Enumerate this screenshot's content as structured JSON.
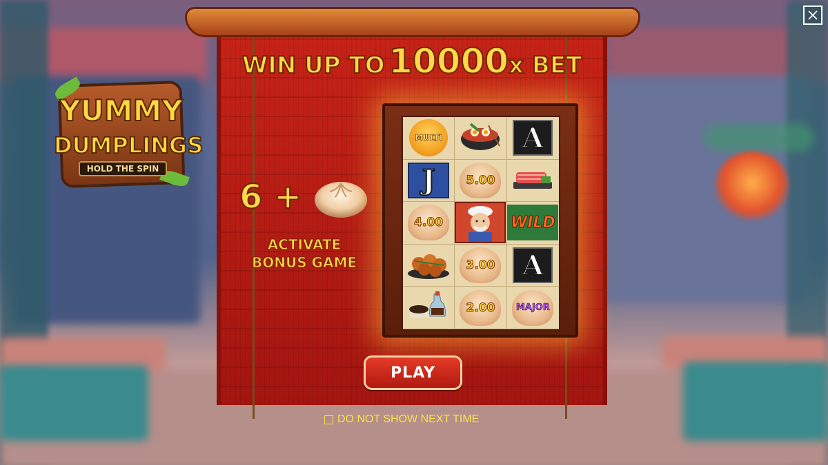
{
  "headline": {
    "prefix": "WIN UP TO",
    "amount": "10000",
    "suffix": "x BET"
  },
  "logo": {
    "line1": "YUMMY",
    "line2": "DUMPLINGS",
    "subtitle": "HOLD THE SPIN"
  },
  "bonus": {
    "count": "6 +",
    "line1": "ACTIVATE",
    "line2": "BONUS GAME"
  },
  "reels": {
    "cells": [
      {
        "type": "multi",
        "label": "MULTI"
      },
      {
        "type": "icon",
        "icon": "noodle-bowl-icon"
      },
      {
        "type": "letter-a",
        "label": "A"
      },
      {
        "type": "letter-j",
        "label": "J"
      },
      {
        "type": "value",
        "label": "5.00"
      },
      {
        "type": "icon",
        "icon": "sushi-icon"
      },
      {
        "type": "value",
        "label": "4.00"
      },
      {
        "type": "chef",
        "icon": "chef-icon"
      },
      {
        "type": "wild",
        "label": "WILD"
      },
      {
        "type": "icon",
        "icon": "takoyaki-icon"
      },
      {
        "type": "value",
        "label": "3.00"
      },
      {
        "type": "letter-a",
        "label": "A"
      },
      {
        "type": "icon",
        "icon": "soy-sauce-icon"
      },
      {
        "type": "value",
        "label": "2.00"
      },
      {
        "type": "major",
        "label": "MAJOR"
      }
    ]
  },
  "play_button": "PLAY",
  "dont_show": "DO NOT SHOW NEXT TIME",
  "colors": {
    "banner_red": "#c62317",
    "gold_text": "#ffd84a",
    "play_red": "#e43a26"
  }
}
